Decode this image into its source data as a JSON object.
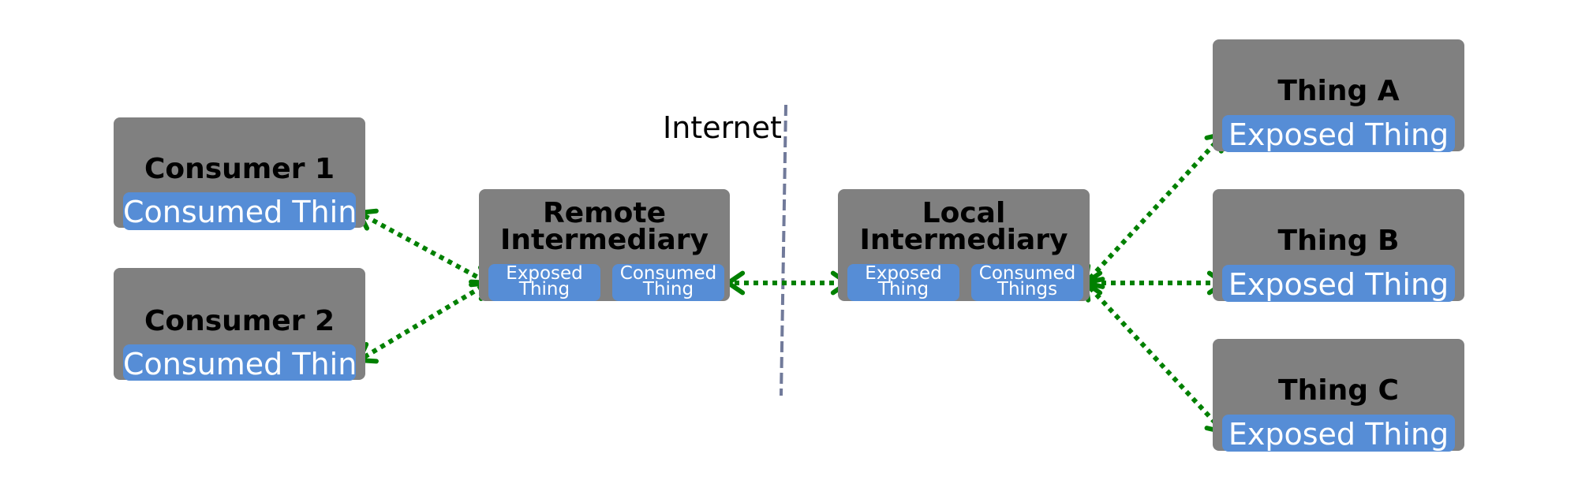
{
  "diagram": {
    "internet_label": "Internet",
    "colors": {
      "node_fill": "#808080",
      "sub_fill": "#568dd6",
      "arrow": "#008000",
      "boundary": "#717a9a"
    },
    "nodes": {
      "consumer1": {
        "title": "Consumer 1",
        "sub": "Consumed Thing"
      },
      "consumer2": {
        "title": "Consumer 2",
        "sub": "Consumed Thing"
      },
      "remote": {
        "title_line1": "Remote",
        "title_line2": "Intermediary",
        "sub_left_line1": "Exposed",
        "sub_left_line2": "Thing",
        "sub_right_line1": "Consumed",
        "sub_right_line2": "Thing"
      },
      "local": {
        "title_line1": "Local",
        "title_line2": "Intermediary",
        "sub_left_line1": "Exposed",
        "sub_left_line2": "Thing",
        "sub_right_line1": "Consumed",
        "sub_right_line2": "Things"
      },
      "thingA": {
        "title": "Thing A",
        "sub": "Exposed Thing"
      },
      "thingB": {
        "title": "Thing B",
        "sub": "Exposed Thing"
      },
      "thingC": {
        "title": "Thing C",
        "sub": "Exposed Thing"
      }
    },
    "connections": [
      {
        "from": "consumer1.consumed-thing",
        "to": "remote.exposed-thing",
        "style": "dotted",
        "arrows": "both"
      },
      {
        "from": "consumer2.consumed-thing",
        "to": "remote.exposed-thing",
        "style": "dotted",
        "arrows": "both"
      },
      {
        "from": "remote.consumed-thing",
        "to": "local.exposed-thing",
        "style": "dotted",
        "arrows": "both"
      },
      {
        "from": "local.consumed-things",
        "to": "thingA.exposed-thing",
        "style": "dotted",
        "arrows": "both"
      },
      {
        "from": "local.consumed-things",
        "to": "thingB.exposed-thing",
        "style": "dotted",
        "arrows": "both"
      },
      {
        "from": "local.consumed-things",
        "to": "thingC.exposed-thing",
        "style": "dotted",
        "arrows": "both"
      }
    ]
  }
}
